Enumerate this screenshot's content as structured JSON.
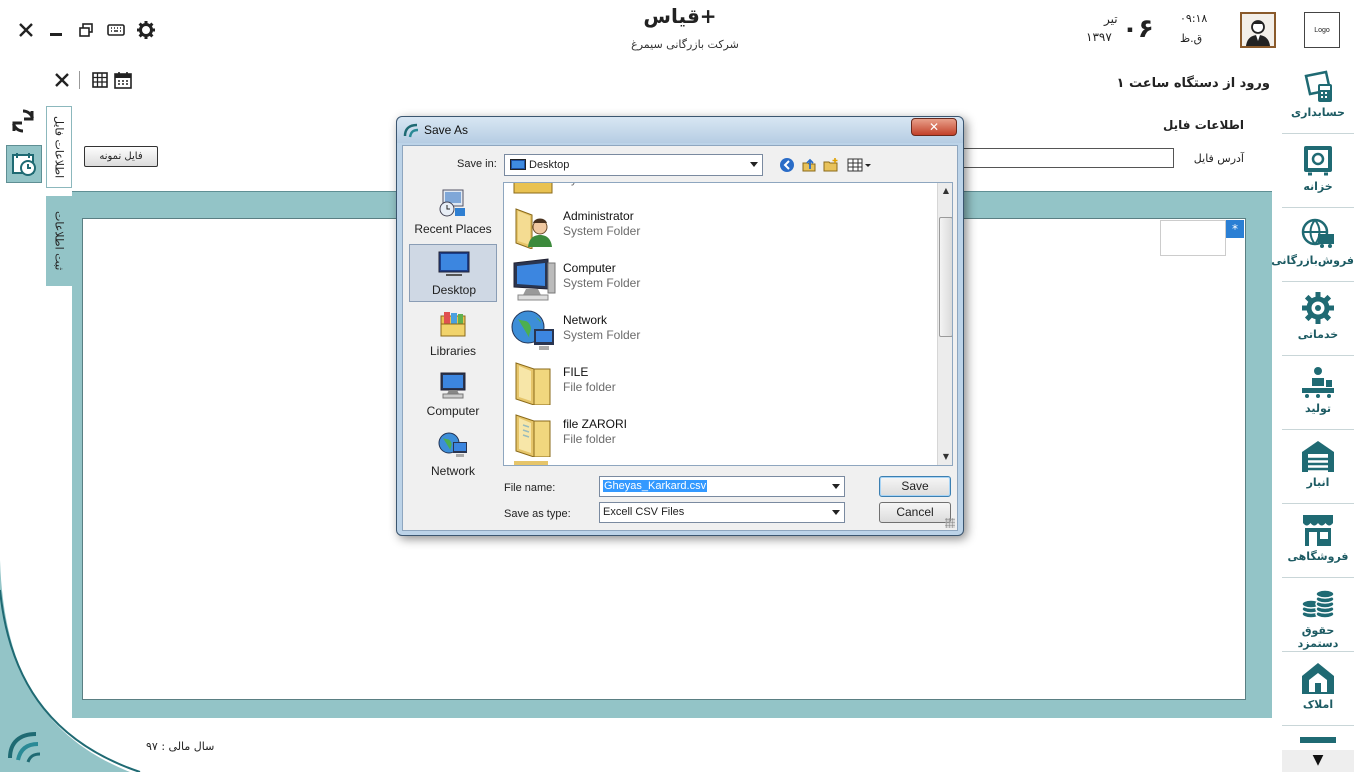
{
  "app": {
    "title": "قیاس+",
    "company": "شرکت بازرگانی سیمرغ",
    "logo_text": "Logo",
    "colors": {
      "teal": "#93c4c7",
      "sidebar_text": "#1d5b63",
      "dark_teal": "#1f6a73"
    }
  },
  "datetime": {
    "day": "۰۶",
    "month": "تیر",
    "year": "۱۳۹۷",
    "time": "۰۹:۱۸",
    "period": "ق.ظ"
  },
  "window_controls": [
    "close-icon",
    "minimize-icon",
    "restore-icon",
    "keyboard-icon",
    "gear-icon"
  ],
  "form": {
    "title": "ورود از دستگاه ساعت ۱",
    "section_title": "اطلاعات فایل",
    "address_label": "آدرس فایل",
    "address_value": "",
    "sample_button": "فایل نمونه",
    "grid_new_row_marker": "*"
  },
  "side_tabs": [
    "اطلاعات فایل",
    "ثبت اطلاعات"
  ],
  "footer": {
    "fiscal_year": "سال مالی : ۹۷"
  },
  "sidebar": {
    "items": [
      {
        "label": "حسابداری",
        "icon": "accounting-icon"
      },
      {
        "label": "خزانه",
        "icon": "safe-icon"
      },
      {
        "label": "فروش‌بازرگانی",
        "icon": "commerce-globe-icon"
      },
      {
        "label": "خدماتی",
        "icon": "gear-service-icon"
      },
      {
        "label": "تولید",
        "icon": "production-icon"
      },
      {
        "label": "انبار",
        "icon": "warehouse-icon"
      },
      {
        "label": "فروشگاهی",
        "icon": "store-icon"
      },
      {
        "label": "حقوق دستمزد",
        "icon": "coins-icon"
      },
      {
        "label": "املاک",
        "icon": "property-icon"
      }
    ]
  },
  "dialog": {
    "title": "Save As",
    "save_in_label": "Save in:",
    "save_in_value": "Desktop",
    "places": [
      {
        "label": "Recent Places",
        "selected": false
      },
      {
        "label": "Desktop",
        "selected": true
      },
      {
        "label": "Libraries",
        "selected": false
      },
      {
        "label": "Computer",
        "selected": false
      },
      {
        "label": "Network",
        "selected": false
      }
    ],
    "files": [
      {
        "name": "",
        "type": "System Folder",
        "icon": "library-folder-icon"
      },
      {
        "name": "Administrator",
        "type": "System Folder",
        "icon": "user-folder-icon"
      },
      {
        "name": "Computer",
        "type": "System Folder",
        "icon": "computer-icon"
      },
      {
        "name": "Network",
        "type": "System Folder",
        "icon": "network-icon"
      },
      {
        "name": "FILE",
        "type": "File folder",
        "icon": "folder-icon"
      },
      {
        "name": "file ZARORI",
        "type": "File folder",
        "icon": "folder-icon"
      }
    ],
    "file_name_label": "File name:",
    "file_name_value": "Gheyas_Karkard.csv",
    "save_type_label": "Save as type:",
    "save_type_value": "Excell CSV Files",
    "save_button": "Save",
    "cancel_button": "Cancel"
  }
}
